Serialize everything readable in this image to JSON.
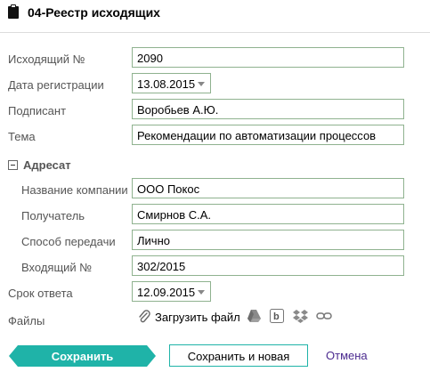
{
  "header": {
    "title": "04-Реестр исходящих",
    "icon": "clipboard-icon"
  },
  "form": {
    "outgoing_no": {
      "label": "Исходящий №",
      "value": "2090"
    },
    "reg_date": {
      "label": "Дата регистрации",
      "value": "13.08.2015"
    },
    "signer": {
      "label": "Подписант",
      "value": "Воробьев А.Ю."
    },
    "subject": {
      "label": "Тема",
      "value": "Рекомендации по автоматизации процессов"
    },
    "addressee": {
      "section_label": "Адресат",
      "company": {
        "label": "Название компании",
        "value": "ООО Покос"
      },
      "recipient": {
        "label": "Получатель",
        "value": "Смирнов С.А."
      },
      "delivery": {
        "label": "Способ передачи",
        "value": "Лично"
      },
      "incoming_no": {
        "label": "Входящий №",
        "value": "302/2015"
      }
    },
    "due_date": {
      "label": "Срок ответа",
      "value": "12.09.2015"
    },
    "files": {
      "label": "Файлы",
      "upload_label": "Загрузить файл"
    }
  },
  "actions": {
    "save": "Сохранить",
    "save_new": "Сохранить и новая",
    "cancel": "Отмена"
  },
  "colors": {
    "accent": "#1fb3a8",
    "field_border": "#8fb28f",
    "cancel": "#4b2a8f"
  }
}
